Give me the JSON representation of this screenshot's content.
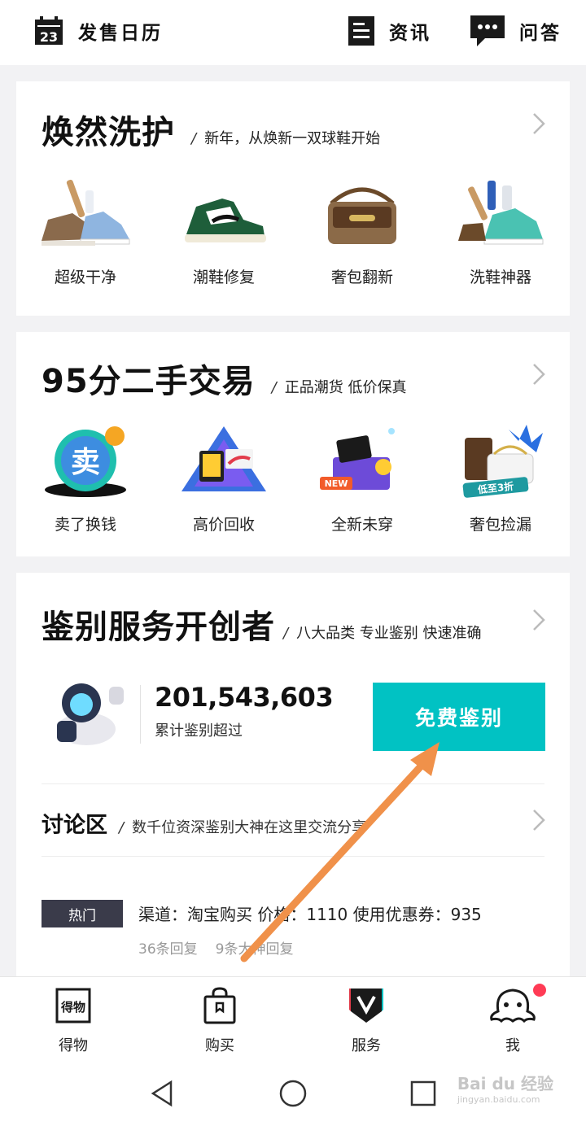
{
  "topbar": {
    "calendar_day": "23",
    "calendar_label": "发售日历",
    "news_label": "资讯",
    "qa_label": "问答"
  },
  "care": {
    "title": "焕然洗护",
    "subtitle": "新年，从焕新一双球鞋开始",
    "items": [
      {
        "label": "超级干净",
        "icon": "dirty-sneaker-cleaning"
      },
      {
        "label": "潮鞋修复",
        "icon": "green-sneaker"
      },
      {
        "label": "奢包翻新",
        "icon": "luxury-bag"
      },
      {
        "label": "洗鞋神器",
        "icon": "shoe-cleaning-kit"
      }
    ]
  },
  "resale": {
    "title": "95分二手交易",
    "subtitle": "正品潮货 低价保真",
    "items": [
      {
        "label": "卖了换钱",
        "badge": "卖",
        "icon": "sell-coin"
      },
      {
        "label": "高价回收",
        "icon": "recycle-box"
      },
      {
        "label": "全新未穿",
        "badge": "NEW",
        "icon": "new-box"
      },
      {
        "label": "奢包捡漏",
        "badge": "低至3折",
        "icon": "bag-deal"
      }
    ]
  },
  "auth": {
    "title": "鉴别服务开创者",
    "subtitle": "八大品类 专业鉴别 快速准确",
    "count": "201,543,603",
    "count_label": "累计鉴别超过",
    "button": "免费鉴别",
    "discussion_title": "讨论区",
    "discussion_sub": "数千位资深鉴别大神在这里交流分享",
    "post": {
      "tag": "热门",
      "title": "渠道：淘宝购买 价格：1110 使用优惠券：935",
      "replies": "36条回复",
      "expert_replies": "9条大神回复"
    }
  },
  "bottom_nav": [
    {
      "label": "得物",
      "icon": "dewu-logo-icon"
    },
    {
      "label": "购买",
      "icon": "shopping-bag-icon"
    },
    {
      "label": "服务",
      "icon": "service-v-icon"
    },
    {
      "label": "我",
      "icon": "profile-mascot-icon"
    }
  ],
  "watermark": {
    "main": "Bai du 经验",
    "sub": "jingyan.baidu.com"
  },
  "colors": {
    "accent": "#01c2c3",
    "arrow": "#f0914a",
    "hot_tag": "#3a3b4a",
    "badge": "#ff3b55"
  }
}
